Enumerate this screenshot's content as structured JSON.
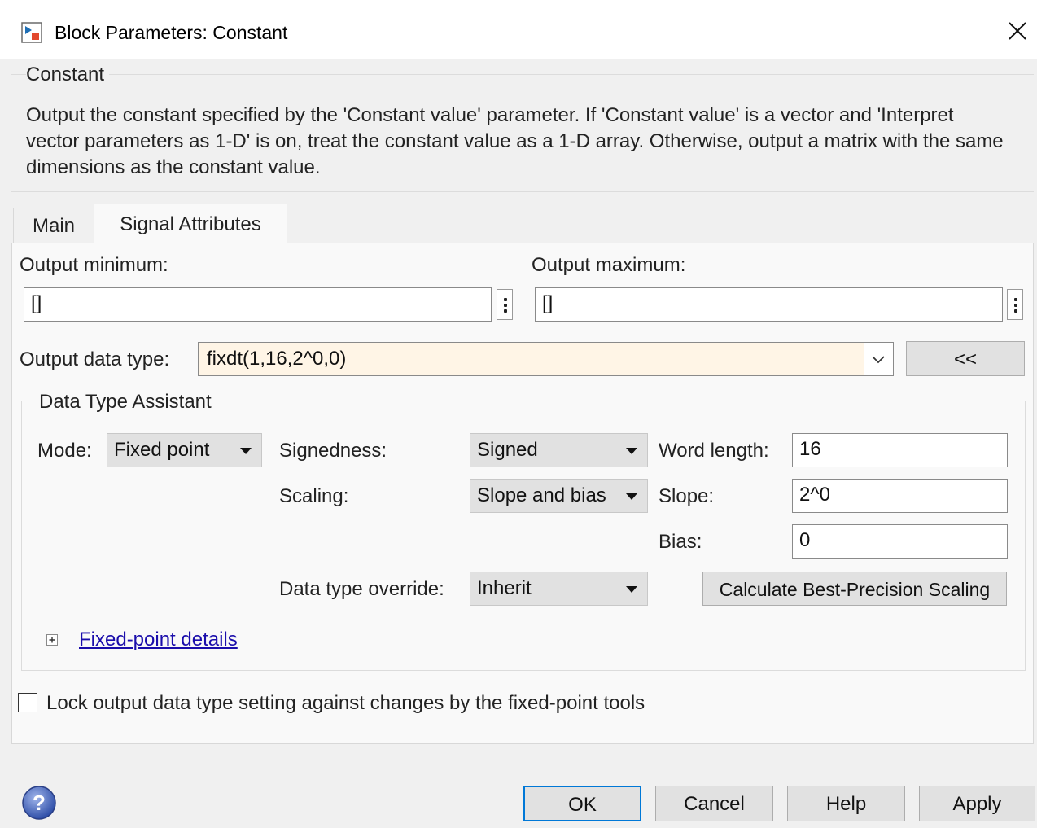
{
  "window": {
    "title": "Block Parameters: Constant",
    "icon": "simulink-block-icon",
    "close_icon": "close-icon"
  },
  "description": {
    "group_title": "Constant",
    "text": "Output the constant specified by the 'Constant value' parameter. If 'Constant value' is a vector and 'Interpret vector parameters as 1-D' is on, treat the constant value as a 1-D array. Otherwise, output a matrix with the same dimensions as the constant value."
  },
  "tabs": [
    {
      "label": "Main",
      "selected": false
    },
    {
      "label": "Signal Attributes",
      "selected": true
    }
  ],
  "signal_attributes": {
    "output_minimum": {
      "label": "Output minimum:",
      "value": "[]"
    },
    "output_maximum": {
      "label": "Output maximum:",
      "value": "[]"
    },
    "output_data_type": {
      "label": "Output data type:",
      "value": "fixdt(1,16,2^0,0)",
      "toggle_button": "<<"
    },
    "data_type_assistant": {
      "title": "Data Type Assistant",
      "mode": {
        "label": "Mode:",
        "value": "Fixed point"
      },
      "signedness": {
        "label": "Signedness:",
        "value": "Signed"
      },
      "scaling": {
        "label": "Scaling:",
        "value": "Slope and bias"
      },
      "data_type_override": {
        "label": "Data type override:",
        "value": "Inherit"
      },
      "word_length": {
        "label": "Word length:",
        "value": "16"
      },
      "slope": {
        "label": "Slope:",
        "value": "2^0"
      },
      "bias": {
        "label": "Bias:",
        "value": "0"
      },
      "calculate_button": "Calculate Best-Precision Scaling",
      "details_link": "Fixed-point details",
      "expander_symbol": "+"
    },
    "lock_checkbox": {
      "label": "Lock output data type setting against changes by the fixed-point tools",
      "checked": false
    }
  },
  "buttons": {
    "ok": "OK",
    "cancel": "Cancel",
    "help": "Help",
    "apply": "Apply",
    "help_icon": "question-icon"
  },
  "colors": {
    "combo_highlight": "#fff5e6",
    "link": "#1a0dab",
    "ok_border": "#0078d7"
  }
}
